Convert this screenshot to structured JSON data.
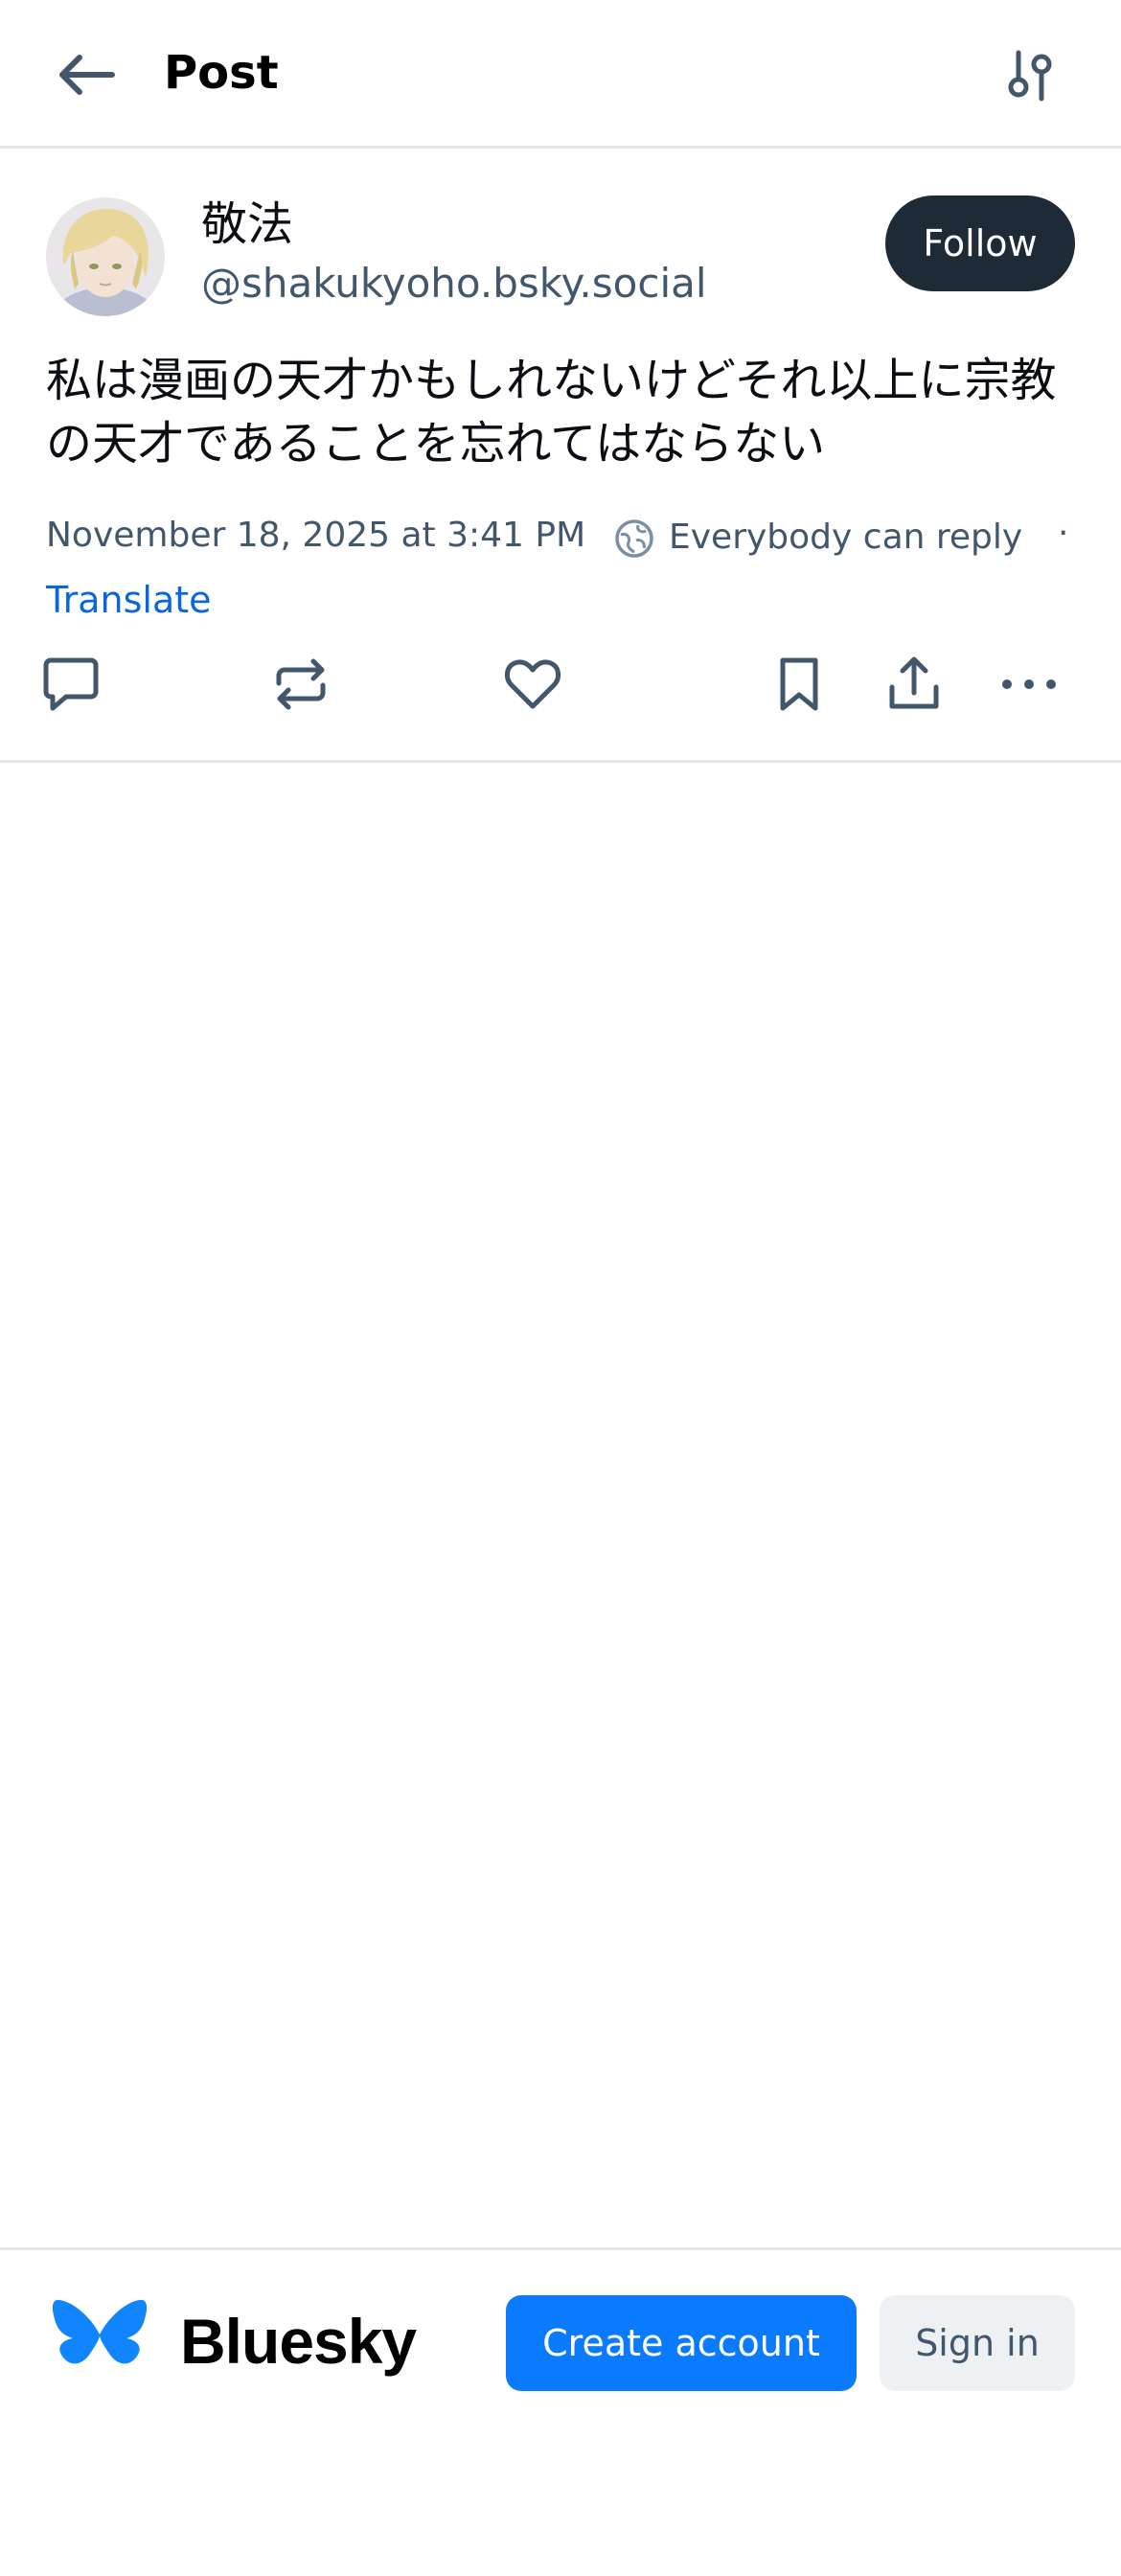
{
  "header": {
    "title": "Post",
    "back_icon": "arrow-left-icon",
    "settings_icon": "sliders-icon"
  },
  "post": {
    "author": {
      "display_name": "敬法",
      "handle": "@shakukyoho.bsky.social",
      "avatar_icon": "avatar-image"
    },
    "follow_label": "Follow",
    "text": "私は漫画の天才かもしれないけどそれ以上に宗教の天才であることを忘れてはならない",
    "date": "November 18, 2025 at 3:41 PM",
    "reply_setting": "Everybody can reply",
    "separator": "·",
    "translate_label": "Translate",
    "actions": {
      "reply_icon": "comment-icon",
      "repost_icon": "repost-icon",
      "like_icon": "heart-icon",
      "bookmark_icon": "bookmark-icon",
      "share_icon": "share-icon",
      "more_icon": "more-icon"
    }
  },
  "footer": {
    "brand_name": "Bluesky",
    "create_account_label": "Create account",
    "sign_in_label": "Sign in"
  },
  "colors": {
    "accent": "#0a7aff",
    "link": "#0a66dc",
    "follow_bg": "#1f2a37",
    "muted_text": "#42576c",
    "divider": "#e3e7ec"
  }
}
